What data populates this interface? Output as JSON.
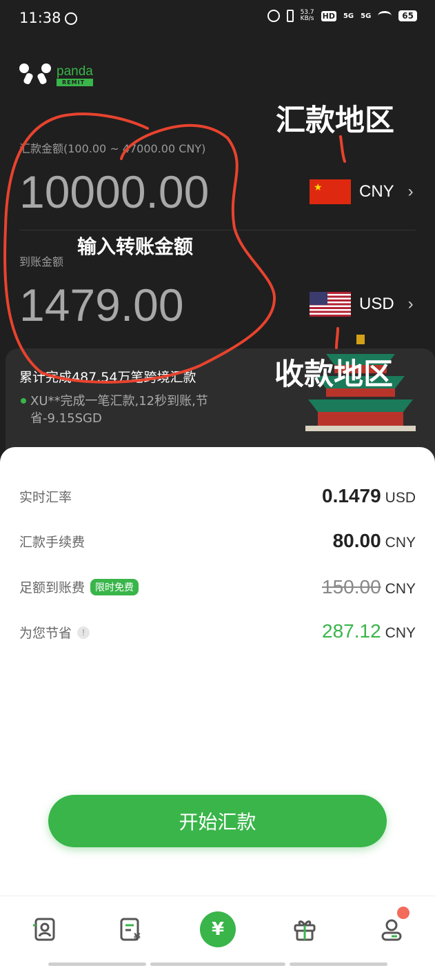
{
  "status_bar": {
    "time": "11:38",
    "net_speed": "53.7",
    "net_unit": "KB/s",
    "hd": "HD",
    "sig1": "5G",
    "sig2": "5G",
    "battery": "65"
  },
  "logo": {
    "word": "panda",
    "sub": "REMIT"
  },
  "annotations": {
    "send_region": "汇款地区",
    "enter_amount": "输入转账金额",
    "receive_region": "收款地区"
  },
  "send": {
    "label": "汇款金额(100.00 ~ 47000.00 CNY)",
    "amount": "10000.00",
    "currency": "CNY",
    "flag_icon": "china-flag-icon"
  },
  "receive": {
    "label": "到账金额",
    "amount": "1479.00",
    "currency": "USD",
    "flag_icon": "usa-flag-icon"
  },
  "banner": {
    "title": "累计完成487.54万笔跨境汇款",
    "ticker": "XU**完成一笔汇款,12秒到账,节省-9.15SGD"
  },
  "details": {
    "rate": {
      "label": "实时汇率",
      "value": "0.1479",
      "unit": "USD"
    },
    "fee": {
      "label": "汇款手续费",
      "value": "80.00",
      "unit": "CNY"
    },
    "full_arrival": {
      "label": "足额到账费",
      "badge": "限时免费",
      "value": "150.00",
      "unit": "CNY"
    },
    "saved": {
      "label": "为您节省",
      "value": "287.12",
      "unit": "CNY"
    }
  },
  "cta": {
    "label": "开始汇款"
  },
  "nav": {
    "items": [
      "contacts-icon",
      "records-icon",
      "remit-icon",
      "gift-icon",
      "profile-icon"
    ],
    "center_symbol": "¥"
  },
  "colors": {
    "brand": "#39b54a",
    "bg_dark": "#1f1f1f",
    "annotation_red": "#e8432e"
  }
}
